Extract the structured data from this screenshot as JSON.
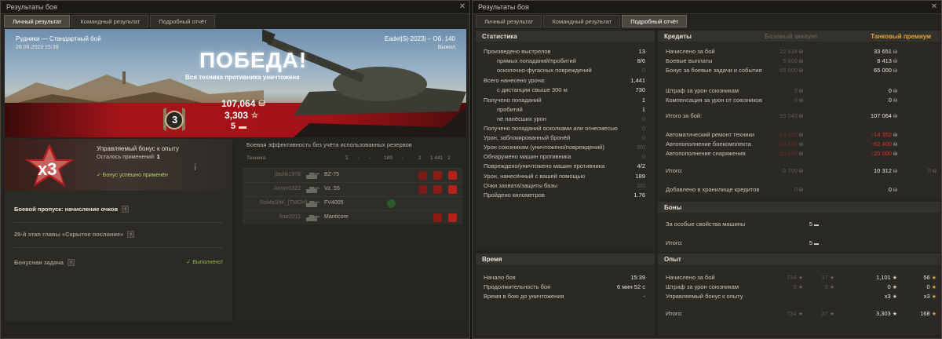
{
  "left_window": {
    "title": "Результаты боя",
    "close": "✕",
    "tabs": [
      "Личный результат",
      "Командный результат",
      "Подробный отчёт"
    ],
    "active_tab": 0,
    "map_name": "Рудники — Стандартный бой",
    "battle_date": "28.06.2023 15:39",
    "player_info": "Eadel|S|-2023| – Об. 140",
    "survival": "Выжил",
    "victory_title": "ПОБЕДА!",
    "victory_sub": "Вся техника противника уничтожена",
    "rank_number": "3",
    "credits": "107,064",
    "xp": "3,303",
    "bonds": "5",
    "bonus": {
      "title": "Управляемый бонус к опыту",
      "remaining_label": "Осталось применений:",
      "remaining_value": "1",
      "applied": "✓ Бонус успешно применён",
      "multiplier": "x3"
    },
    "tasks": [
      {
        "label": "Боевой пропуск: начисление очков",
        "status": "",
        "dim": false
      },
      {
        "label": "29-й этап главы «Скрытое послание»",
        "status": "",
        "dim": true
      },
      {
        "label": "Бонусная задача",
        "status": "✓ Выполнено!",
        "dim": true
      }
    ],
    "team": {
      "title": "Боевая эффективность без учёта использованных резервов",
      "columns": [
        "Техника",
        "Σ",
        "-",
        "-",
        "189",
        "-",
        "2",
        "1 441",
        "2"
      ],
      "rows": [
        {
          "player": "jlastik1978",
          "tank": "BZ-75"
        },
        {
          "player": "Anton0322",
          "tank": "Vz. 55"
        },
        {
          "player": "RoMaShK_[TMGH]",
          "tank": "FV4005"
        },
        {
          "player": "fear2011",
          "tank": "Manticore"
        }
      ]
    }
  },
  "right_window": {
    "title": "Результаты боя",
    "close": "✕",
    "tabs": [
      "Личный результат",
      "Командный результат",
      "Подробный отчёт"
    ],
    "active_tab": 2,
    "stats": {
      "head": "Статистика",
      "rows": [
        {
          "label": "Произведено выстрелов",
          "value": "13",
          "indent": false,
          "dim": false
        },
        {
          "label": "прямых попаданий/пробитий",
          "value": "8/6",
          "indent": true,
          "dim": false
        },
        {
          "label": "осколочно-фугасных повреждений",
          "value": "0",
          "indent": true,
          "dim": true
        },
        {
          "label": "Всего нанесено урона:",
          "value": "1,441",
          "indent": false,
          "dim": false
        },
        {
          "label": "с дистанции свыше 300 м",
          "value": "730",
          "indent": true,
          "dim": false
        },
        {
          "label": "Получено попаданий",
          "value": "1",
          "indent": false,
          "dim": false
        },
        {
          "label": "пробитий",
          "value": "1",
          "indent": true,
          "dim": false
        },
        {
          "label": "не нанёсших урон",
          "value": "0",
          "indent": true,
          "dim": true
        },
        {
          "label": "Получено попаданий осколками или огнесмесью",
          "value": "0",
          "indent": false,
          "dim": true
        },
        {
          "label": "Урон, заблокированный бронёй",
          "value": "0",
          "indent": false,
          "dim": true
        },
        {
          "label": "Урон союзникам (уничтожено/повреждений)",
          "value": "0/0",
          "indent": false,
          "dim": true
        },
        {
          "label": "Обнаружено машин противника",
          "value": "0",
          "indent": false,
          "dim": true
        },
        {
          "label": "Повреждено/уничтожено машин противника",
          "value": "4/2",
          "indent": false,
          "dim": false
        },
        {
          "label": "Урон, нанесённый с вашей помощью",
          "value": "189",
          "indent": false,
          "dim": false
        },
        {
          "label": "Очки захвата/защиты базы",
          "value": "0/0",
          "indent": false,
          "dim": true
        },
        {
          "label": "Пройдено километров",
          "value": "1.76",
          "indent": false,
          "dim": false
        }
      ]
    },
    "time": {
      "head": "Время",
      "rows": [
        {
          "label": "Начало боя",
          "value": "15:39"
        },
        {
          "label": "Продолжительность боя",
          "value": "6 мин 52 с"
        },
        {
          "label": "Время в бою до уничтожения",
          "value": "-"
        }
      ]
    },
    "credits": {
      "head": "Кредиты",
      "basic_head": "Базовый аккаунт",
      "premium_head": "Танковый премиум",
      "rows": [
        {
          "label": "Начислено за бой",
          "basic": "22 434",
          "prem": "33 651",
          "extra": "",
          "red": false
        },
        {
          "label": "Боевые выплаты",
          "basic": "5 609",
          "prem": "8 413",
          "extra": "",
          "red": false
        },
        {
          "label": "Бонус за боевые задачи и события",
          "basic": "65 000",
          "prem": "65 000",
          "extra": "",
          "red": false
        },
        {
          "label": "Штраф за урон союзникам",
          "basic": "0",
          "prem": "0",
          "extra": "",
          "red": false
        },
        {
          "label": "Компенсация за урон от союзников",
          "basic": "0",
          "prem": "0",
          "extra": "",
          "red": false
        },
        {
          "label": "Итого за бой:",
          "basic": "93 043",
          "prem": "107 064",
          "extra": "",
          "red": false
        },
        {
          "label": "Автоматический ремонт техники",
          "basic": "-14 352",
          "prem": "-14 352",
          "extra": "",
          "red": true
        },
        {
          "label": "Автопополнение боекомплекта",
          "basic": "-62 400",
          "prem": "-62 400",
          "extra": "",
          "red": true
        },
        {
          "label": "Автопополнение снаряжения",
          "basic": "-20 000",
          "prem": "-20 000",
          "extra": "",
          "red": true
        },
        {
          "label": "Итого:",
          "basic": "-3 709",
          "prem": "10 312",
          "extra": "0",
          "red": false
        },
        {
          "label": "Добавлено в хранилище кредитов",
          "basic": "0",
          "prem": "0",
          "extra": "",
          "red": false
        }
      ]
    },
    "bonds": {
      "head": "Боны",
      "rows": [
        {
          "label": "За особые свойства машины",
          "value": "5"
        },
        {
          "label": "Итого:",
          "value": "5"
        }
      ]
    },
    "xp": {
      "head": "Опыт",
      "rows": [
        {
          "label": "Начислено за бой",
          "basic": "734",
          "basic2": "37",
          "prem": "1,101",
          "prem2": "56"
        },
        {
          "label": "Штраф за урон союзникам",
          "basic": "0",
          "basic2": "0",
          "prem": "0",
          "prem2": "0"
        },
        {
          "label": "Управляемый бонус к опыту",
          "basic": "",
          "basic2": "",
          "prem": "x3",
          "prem2": "x3"
        },
        {
          "label": "Итого:",
          "basic": "734",
          "basic2": "37",
          "prem": "3,303",
          "prem2": "168"
        }
      ]
    }
  }
}
